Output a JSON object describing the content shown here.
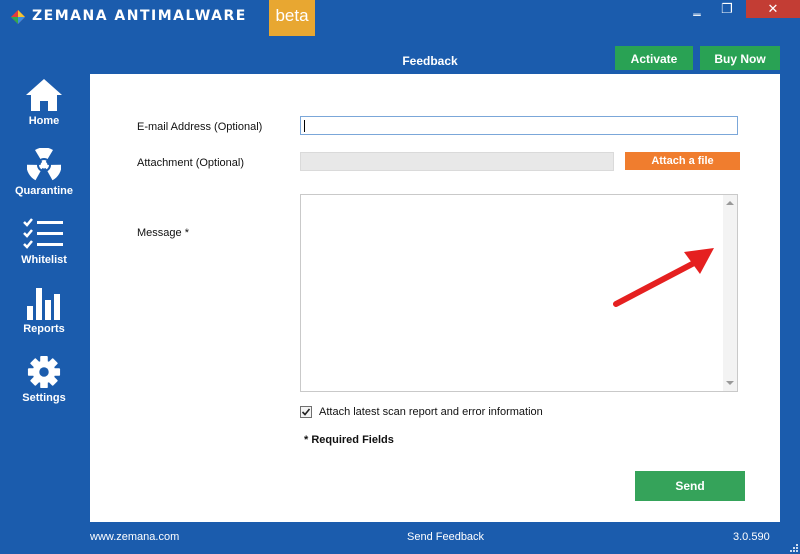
{
  "window": {
    "title": "ZEMANA ANTIMALWARE",
    "badge": "beta",
    "minimize_glyph": "‗",
    "maximize_glyph": "❐",
    "close_glyph": "✕"
  },
  "header": {
    "page_title": "Feedback",
    "activate_label": "Activate",
    "buy_label": "Buy Now"
  },
  "sidebar": {
    "items": [
      {
        "label": "Home",
        "icon": "home-icon"
      },
      {
        "label": "Quarantine",
        "icon": "radiation-icon"
      },
      {
        "label": "Whitelist",
        "icon": "checklist-icon"
      },
      {
        "label": "Reports",
        "icon": "bar-chart-icon"
      },
      {
        "label": "Settings",
        "icon": "gear-icon"
      }
    ]
  },
  "form": {
    "email_label": "E-mail Address  (Optional)",
    "email_value": "",
    "attachment_label": "Attachment (Optional)",
    "attach_button": "Attach a file",
    "message_label": "Message *",
    "message_value": "",
    "checkbox_label": "Attach latest scan report and error information",
    "checkbox_checked": true,
    "required_note": "* Required Fields",
    "send_button": "Send"
  },
  "footer": {
    "website": "www.zemana.com",
    "center": "Send Feedback",
    "version": "3.0.590"
  },
  "colors": {
    "background": "#1b5cad",
    "accent_green": "#29a254",
    "accent_orange": "#f07d2e",
    "arrow_red": "#e52020",
    "badge": "#e8a731"
  }
}
